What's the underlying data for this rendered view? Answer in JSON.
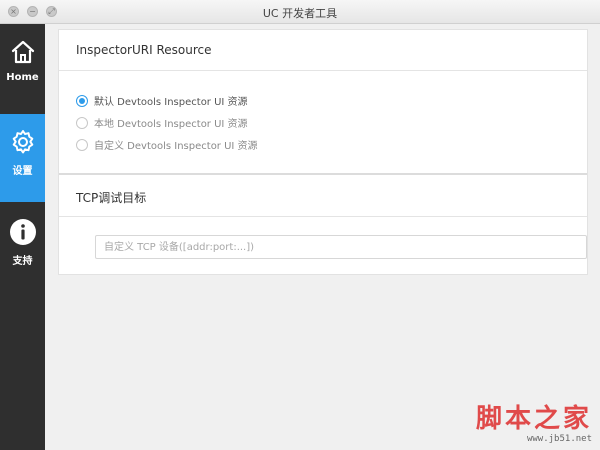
{
  "window": {
    "title": "UC 开发者工具",
    "controls": [
      {
        "name": "close",
        "glyph": "×"
      },
      {
        "name": "minimize",
        "glyph": "−"
      },
      {
        "name": "maximize",
        "glyph": "⤢"
      }
    ]
  },
  "sidebar": {
    "accent": "#2d9bea",
    "background": "#2f2f2f",
    "items": [
      {
        "label": "Home",
        "icon": "home-icon",
        "active": false
      },
      {
        "label": "设置",
        "icon": "gear-icon",
        "active": true
      },
      {
        "label": "支持",
        "icon": "info-icon",
        "active": false
      }
    ]
  },
  "inspector": {
    "title": "InspectorURI Resource",
    "options": [
      {
        "label": "默认 Devtools Inspector UI 资源",
        "checked": true
      },
      {
        "label": "本地 Devtools Inspector UI 资源",
        "checked": false
      },
      {
        "label": "自定义 Devtools Inspector UI 资源",
        "checked": false
      }
    ]
  },
  "tcp": {
    "title": "TCP调试目标",
    "placeholder": "自定义 TCP 设备([addr:port:...])",
    "value": ""
  },
  "watermark": {
    "text": "脚本之家",
    "url": "www.jb51.net"
  }
}
